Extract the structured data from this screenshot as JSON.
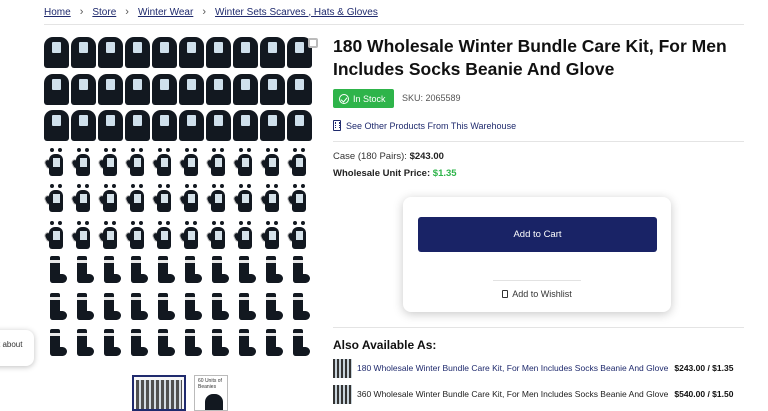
{
  "breadcrumb": [
    "Home",
    "Store",
    "Winter Wear",
    "Winter Sets Scarves , Hats & Gloves"
  ],
  "product": {
    "title": "180 Wholesale Winter Bundle Care Kit, For Men Includes Socks Beanie And Glove",
    "stock_label": "In Stock",
    "sku": "SKU: 2065589",
    "warehouse_link": "See Other Products From This Warehouse",
    "case_label": "Case (180 Pairs):",
    "case_price": "$243.00",
    "unit_label": "Wholesale Unit Price:",
    "unit_price": "$1.35"
  },
  "gallery": {
    "rows": [
      "beanie",
      "beanie",
      "beanie",
      "glove",
      "glove",
      "glove",
      "sock",
      "sock",
      "sock"
    ],
    "thumb2_label": "60 Units of Beanies"
  },
  "actions": {
    "add_to_cart": "Add to Cart",
    "add_to_wishlist": "Add to Wishlist"
  },
  "also_available": {
    "heading": "Also Available As:",
    "items": [
      {
        "text": "180 Wholesale Winter Bundle Care Kit, For Men Includes Socks Beanie And Glove",
        "price": "$243.00 / $1.35"
      },
      {
        "text": "360 Wholesale Winter Bundle Care Kit, For Men Includes Socks Beanie And Glove",
        "price": "$540.00 / $1.50"
      }
    ]
  },
  "left_popup": "t about",
  "colors": {
    "navy": "#192366",
    "green": "#2eb44a"
  }
}
